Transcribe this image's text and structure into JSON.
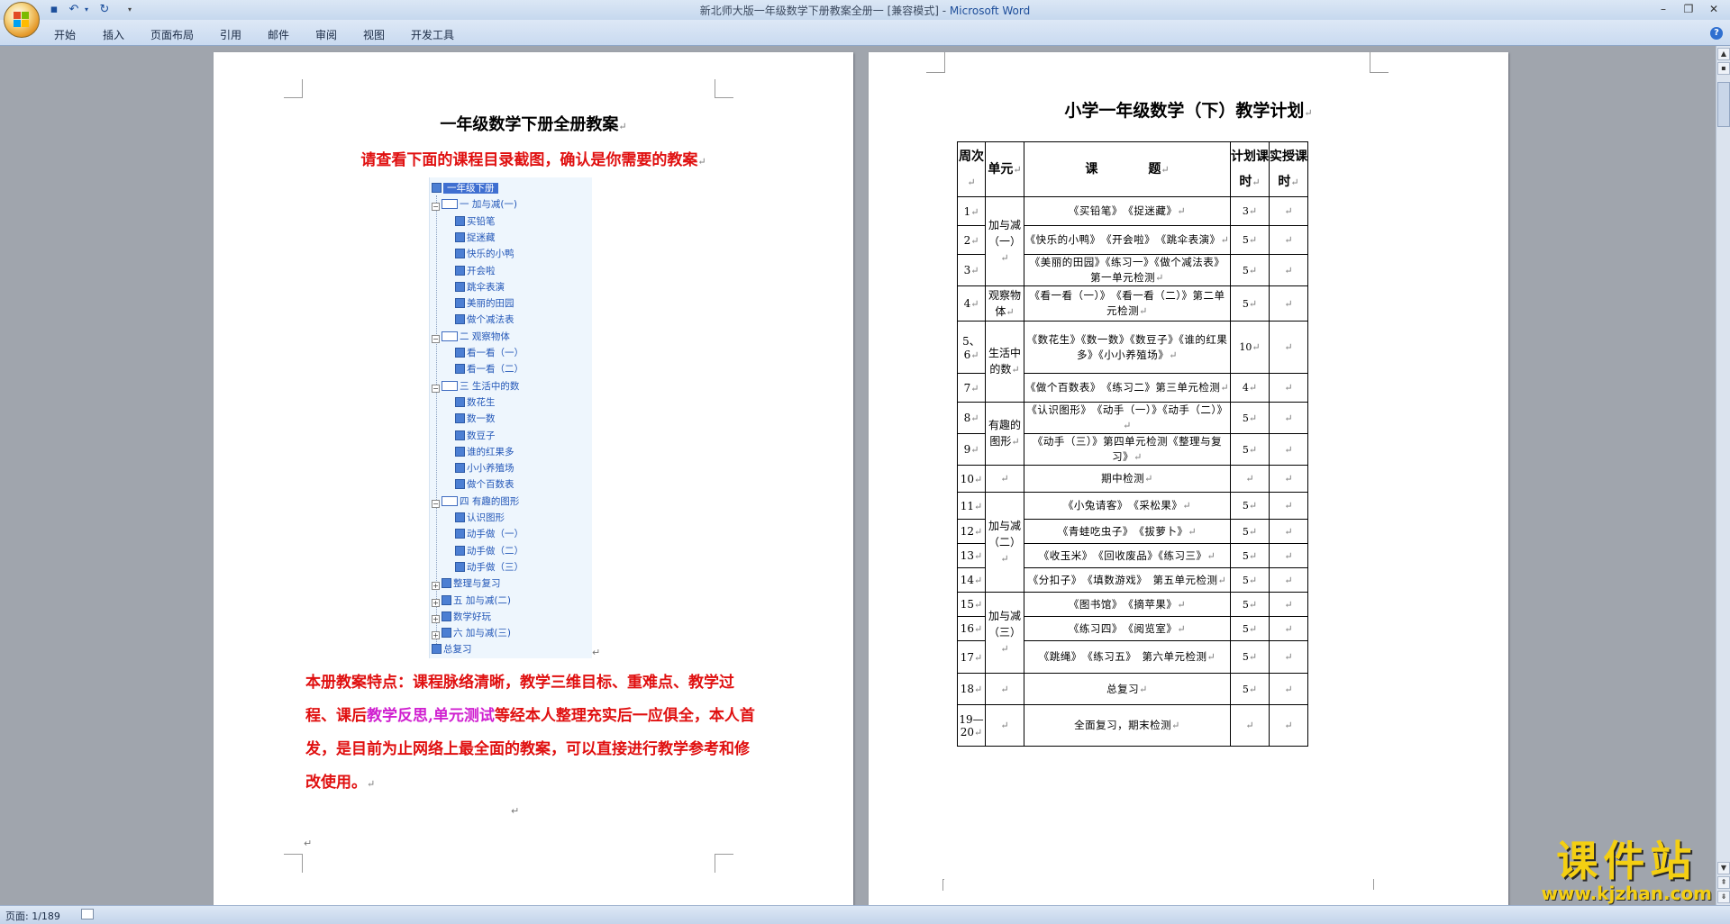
{
  "window": {
    "title_doc": "新北师大版一年级数学下册教案全册一 [兼容模式] - ",
    "title_app": "Microsoft Word"
  },
  "ribbon": {
    "tabs": [
      "开始",
      "插入",
      "页面布局",
      "引用",
      "邮件",
      "审阅",
      "视图",
      "开发工具"
    ]
  },
  "page1": {
    "title": "一年级数学下册全册教案",
    "subtitle": "请查看下面的课程目录截图，确认是你需要的教案",
    "tree": [
      {
        "label": "一年级下册",
        "icon": "root",
        "level": 0
      },
      {
        "label": "一 加与减(一)",
        "icon": "book",
        "level": 0
      },
      {
        "label": "买铅笔",
        "icon": "doc",
        "level": 1
      },
      {
        "label": "捉迷藏",
        "icon": "doc",
        "level": 1
      },
      {
        "label": "快乐的小鸭",
        "icon": "doc",
        "level": 1
      },
      {
        "label": "开会啦",
        "icon": "doc",
        "level": 1
      },
      {
        "label": "跳伞表演",
        "icon": "doc",
        "level": 1
      },
      {
        "label": "美丽的田园",
        "icon": "doc",
        "level": 1
      },
      {
        "label": "做个减法表",
        "icon": "doc",
        "level": 1
      },
      {
        "label": "二 观察物体",
        "icon": "book",
        "level": 0
      },
      {
        "label": "看一看（一）",
        "icon": "doc",
        "level": 1
      },
      {
        "label": "看一看（二）",
        "icon": "doc",
        "level": 1
      },
      {
        "label": "三 生活中的数",
        "icon": "book",
        "level": 0
      },
      {
        "label": "数花生",
        "icon": "doc",
        "level": 1
      },
      {
        "label": "数一数",
        "icon": "doc",
        "level": 1
      },
      {
        "label": "数豆子",
        "icon": "doc",
        "level": 1
      },
      {
        "label": "谁的红果多",
        "icon": "doc",
        "level": 1
      },
      {
        "label": "小小养殖场",
        "icon": "doc",
        "level": 1
      },
      {
        "label": "做个百数表",
        "icon": "doc",
        "level": 1
      },
      {
        "label": "四 有趣的图形",
        "icon": "book",
        "level": 0
      },
      {
        "label": "认识图形",
        "icon": "doc",
        "level": 1
      },
      {
        "label": "动手做（一）",
        "icon": "doc",
        "level": 1
      },
      {
        "label": "动手做（二）",
        "icon": "doc",
        "level": 1
      },
      {
        "label": "动手做（三）",
        "icon": "doc",
        "level": 1
      },
      {
        "label": "整理与复习",
        "icon": "link",
        "level": 0
      },
      {
        "label": "五 加与减(二)",
        "icon": "link",
        "level": 0
      },
      {
        "label": "数学好玩",
        "icon": "link",
        "level": 0
      },
      {
        "label": "六 加与减(三)",
        "icon": "link",
        "level": 0
      },
      {
        "label": "总复习",
        "icon": "doc",
        "level": 0
      }
    ],
    "features": {
      "part1": "本册教案特点：课程脉络清晰，教学三维目标、重难点、教学过程、课后",
      "highlight": "教学反思,单元测试",
      "part2": "等经本人整理充实后一应俱全，本人首发，是目前为止网络上最全面的教案，可以直接进行教学参考和修改使用。"
    },
    "return_mark": "↵"
  },
  "page2": {
    "title": "小学一年级数学（下）教学计划",
    "headers": {
      "week": "周次",
      "unit": "单元",
      "lesson": "课　　　　题",
      "plan": "计划课时",
      "actual": "实授课时"
    },
    "rows": [
      {
        "week": "1",
        "unit": "加与减（一）",
        "unit_span": 3,
        "lesson": "《买铅笔》　《捉迷藏》",
        "plan": "3",
        "actual": ""
      },
      {
        "week": "2",
        "lesson": "《快乐的小鸭》　《开会啦》　《跳伞表演》",
        "plan": "5",
        "actual": ""
      },
      {
        "week": "3",
        "lesson": "《美丽的田园》《练习一》《做个减法表》第一单元检测",
        "plan": "5",
        "actual": ""
      },
      {
        "week": "4",
        "unit": "观察物体",
        "unit_span": 1,
        "lesson": "《看一看（一）》　《看一看（二）》第二单元检测",
        "plan": "5",
        "actual": ""
      },
      {
        "week": "5、6",
        "unit": "生活中的数",
        "unit_span": 2,
        "lesson": "《数花生》《数一数》《数豆子》《谁的红果多》《小小养殖场》",
        "plan": "10",
        "actual": ""
      },
      {
        "week": "7",
        "lesson": "《做个百数表》　《练习二》第三单元检测",
        "plan": "4",
        "actual": ""
      },
      {
        "week": "8",
        "unit": "有趣的图形",
        "unit_span": 2,
        "lesson": "《认识图形》　《动手（一）》《动手（二）》",
        "plan": "5",
        "actual": ""
      },
      {
        "week": "9",
        "lesson": "《动手（三）》第四单元检测《整理与复习》",
        "plan": "5",
        "actual": ""
      },
      {
        "week": "10",
        "unit": "",
        "unit_span": 1,
        "lesson": "期中检测",
        "plan": "",
        "actual": ""
      },
      {
        "week": "11",
        "unit": "加与减（二）",
        "unit_span": 4,
        "lesson": "《小兔请客》　《采松果》",
        "plan": "5",
        "actual": ""
      },
      {
        "week": "12",
        "lesson": "《青蛙吃虫子》　《拔萝卜》",
        "plan": "5",
        "actual": ""
      },
      {
        "week": "13",
        "lesson": "《收玉米》　《回收废品》《练习三》",
        "plan": "5",
        "actual": ""
      },
      {
        "week": "14",
        "lesson": "《分扣子》　《填数游戏》　第五单元检测",
        "plan": "5",
        "actual": ""
      },
      {
        "week": "15",
        "unit": "加与减（三）",
        "unit_span": 3,
        "lesson": "《图书馆》　《摘苹果》",
        "plan": "5",
        "actual": ""
      },
      {
        "week": "16",
        "lesson": "《练习四》　《阅览室》",
        "plan": "5",
        "actual": ""
      },
      {
        "week": "17",
        "lesson": "《跳绳》　《练习五》　第六单元检测",
        "plan": "5",
        "actual": ""
      },
      {
        "week": "18",
        "unit": "",
        "unit_span": 1,
        "lesson": "总复习",
        "plan": "5",
        "actual": ""
      },
      {
        "week": "19—20",
        "unit": "",
        "unit_span": 1,
        "lesson": "全面复习，期末检测",
        "plan": "",
        "actual": ""
      }
    ]
  },
  "status": {
    "page_info": "页面: 1/189"
  },
  "watermark": {
    "brand": "课件站",
    "url": "www.kjzhan.com"
  }
}
